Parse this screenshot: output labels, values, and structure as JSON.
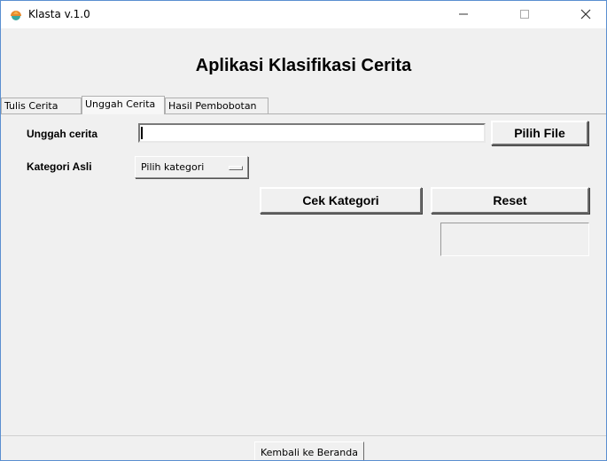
{
  "window": {
    "title": "Klasta v.1.0",
    "icon": "klasta-logo-icon",
    "controls": {
      "minimize": "minimize-icon",
      "maximize": "maximize-icon",
      "close": "close-icon"
    }
  },
  "header": {
    "title": "Aplikasi Klasifikasi Cerita"
  },
  "tabs": [
    {
      "label": "Tulis Cerita",
      "active": false
    },
    {
      "label": "Unggah Cerita",
      "active": true
    },
    {
      "label": "Hasil Pembobotan",
      "active": false
    }
  ],
  "upload_form": {
    "upload_label": "Unggah cerita",
    "file_value": "",
    "choose_file_button": "Pilih File",
    "category_label": "Kategori Asli",
    "category_dropdown": {
      "selected": "Pilih kategori"
    },
    "check_button": "Cek Kategori",
    "reset_button": "Reset",
    "result_value": ""
  },
  "footer": {
    "home_button": "Kembali ke Beranda"
  },
  "colors": {
    "background": "#f0f0f0",
    "titlebar": "#ffffff",
    "window_border": "#5a8fd0",
    "logo_orange": "#e8892c",
    "logo_teal": "#3aa8a0"
  }
}
